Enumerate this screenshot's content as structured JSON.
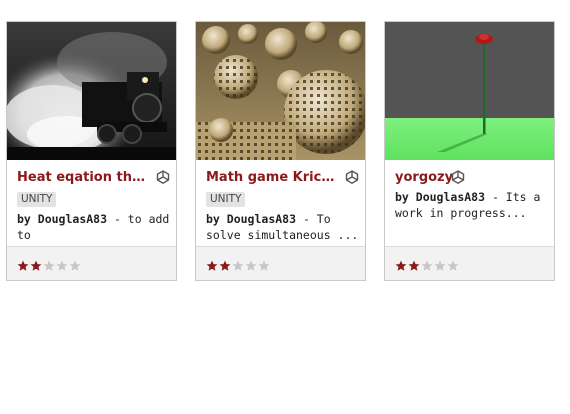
{
  "colors": {
    "title": "#8b1a1a",
    "star_filled": "#8b1a1a",
    "star_empty": "#c8c8c8"
  },
  "cards": [
    {
      "title": "Heat eqation the fi...",
      "badge": "UNITY",
      "author_prefix": "by ",
      "author": "DouglasA83",
      "description": " - to add to",
      "rating": 2,
      "max_rating": 5,
      "icon": "unity-icon"
    },
    {
      "title": "Math game Kricaza...",
      "badge": "UNITY",
      "author_prefix": "by ",
      "author": "DouglasA83",
      "description": " - To solve simultaneous ...",
      "rating": 2,
      "max_rating": 5,
      "icon": "unity-icon"
    },
    {
      "title": "yorgozy",
      "author_prefix": "by ",
      "author": "DouglasA83",
      "description": " - Its a work in progress...",
      "rating": 2,
      "max_rating": 5,
      "icon": "unity-icon"
    }
  ]
}
